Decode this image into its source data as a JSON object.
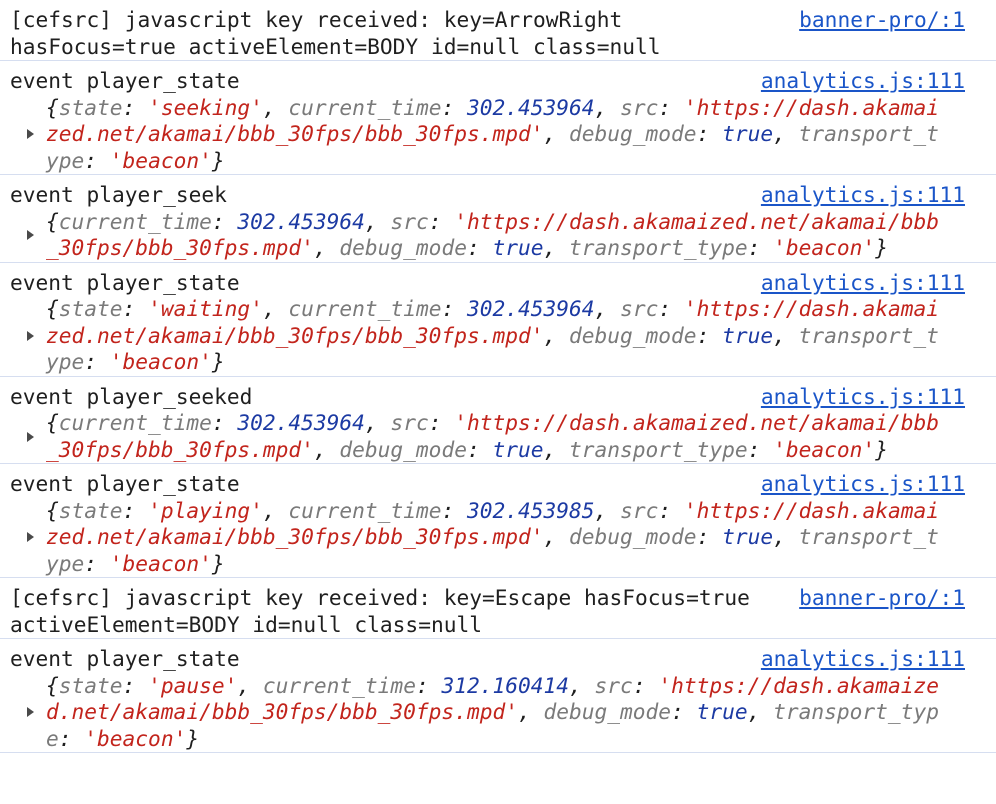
{
  "console": {
    "entries": [
      {
        "kind": "text",
        "lines": [
          "[cefsrc] javascript key received: key=ArrowRight",
          "hasFocus=true activeElement=BODY id=null class=null"
        ],
        "source": "banner-pro/:1"
      },
      {
        "kind": "object",
        "title": "event player_state",
        "source": "analytics.js:111",
        "lines": [
          [
            [
              "p",
              "{"
            ],
            [
              "k",
              "state"
            ],
            [
              "p",
              ": "
            ],
            [
              "s",
              "'seeking'"
            ],
            [
              "p",
              ", "
            ],
            [
              "k",
              "current_time"
            ],
            [
              "p",
              ": "
            ],
            [
              "n",
              "302.453964"
            ],
            [
              "p",
              ", "
            ],
            [
              "k",
              "src"
            ],
            [
              "p",
              ": "
            ],
            [
              "s",
              "'https://dash.akamai"
            ]
          ],
          [
            [
              "s",
              "zed.net/akamai/bbb_30fps/bbb_30fps.mpd'"
            ],
            [
              "p",
              ", "
            ],
            [
              "k",
              "debug_mode"
            ],
            [
              "p",
              ": "
            ],
            [
              "b",
              "true"
            ],
            [
              "p",
              ", "
            ],
            [
              "k",
              "transport_t"
            ]
          ],
          [
            [
              "k",
              "ype"
            ],
            [
              "p",
              ": "
            ],
            [
              "s",
              "'beacon'"
            ],
            [
              "p",
              "}"
            ]
          ]
        ]
      },
      {
        "kind": "object",
        "title": "event player_seek",
        "source": "analytics.js:111",
        "lines": [
          [
            [
              "p",
              "{"
            ],
            [
              "k",
              "current_time"
            ],
            [
              "p",
              ": "
            ],
            [
              "n",
              "302.453964"
            ],
            [
              "p",
              ", "
            ],
            [
              "k",
              "src"
            ],
            [
              "p",
              ": "
            ],
            [
              "s",
              "'https://dash.akamaized.net/akamai/bbb"
            ]
          ],
          [
            [
              "s",
              "_30fps/bbb_30fps.mpd'"
            ],
            [
              "p",
              ", "
            ],
            [
              "k",
              "debug_mode"
            ],
            [
              "p",
              ": "
            ],
            [
              "b",
              "true"
            ],
            [
              "p",
              ", "
            ],
            [
              "k",
              "transport_type"
            ],
            [
              "p",
              ": "
            ],
            [
              "s",
              "'beacon'"
            ],
            [
              "p",
              "}"
            ]
          ]
        ]
      },
      {
        "kind": "object",
        "title": "event player_state",
        "source": "analytics.js:111",
        "lines": [
          [
            [
              "p",
              "{"
            ],
            [
              "k",
              "state"
            ],
            [
              "p",
              ": "
            ],
            [
              "s",
              "'waiting'"
            ],
            [
              "p",
              ", "
            ],
            [
              "k",
              "current_time"
            ],
            [
              "p",
              ": "
            ],
            [
              "n",
              "302.453964"
            ],
            [
              "p",
              ", "
            ],
            [
              "k",
              "src"
            ],
            [
              "p",
              ": "
            ],
            [
              "s",
              "'https://dash.akamai"
            ]
          ],
          [
            [
              "s",
              "zed.net/akamai/bbb_30fps/bbb_30fps.mpd'"
            ],
            [
              "p",
              ", "
            ],
            [
              "k",
              "debug_mode"
            ],
            [
              "p",
              ": "
            ],
            [
              "b",
              "true"
            ],
            [
              "p",
              ", "
            ],
            [
              "k",
              "transport_t"
            ]
          ],
          [
            [
              "k",
              "ype"
            ],
            [
              "p",
              ": "
            ],
            [
              "s",
              "'beacon'"
            ],
            [
              "p",
              "}"
            ]
          ]
        ]
      },
      {
        "kind": "object",
        "title": "event player_seeked",
        "source": "analytics.js:111",
        "lines": [
          [
            [
              "p",
              "{"
            ],
            [
              "k",
              "current_time"
            ],
            [
              "p",
              ": "
            ],
            [
              "n",
              "302.453964"
            ],
            [
              "p",
              ", "
            ],
            [
              "k",
              "src"
            ],
            [
              "p",
              ": "
            ],
            [
              "s",
              "'https://dash.akamaized.net/akamai/bbb"
            ]
          ],
          [
            [
              "s",
              "_30fps/bbb_30fps.mpd'"
            ],
            [
              "p",
              ", "
            ],
            [
              "k",
              "debug_mode"
            ],
            [
              "p",
              ": "
            ],
            [
              "b",
              "true"
            ],
            [
              "p",
              ", "
            ],
            [
              "k",
              "transport_type"
            ],
            [
              "p",
              ": "
            ],
            [
              "s",
              "'beacon'"
            ],
            [
              "p",
              "}"
            ]
          ]
        ]
      },
      {
        "kind": "object",
        "title": "event player_state",
        "source": "analytics.js:111",
        "lines": [
          [
            [
              "p",
              "{"
            ],
            [
              "k",
              "state"
            ],
            [
              "p",
              ": "
            ],
            [
              "s",
              "'playing'"
            ],
            [
              "p",
              ", "
            ],
            [
              "k",
              "current_time"
            ],
            [
              "p",
              ": "
            ],
            [
              "n",
              "302.453985"
            ],
            [
              "p",
              ", "
            ],
            [
              "k",
              "src"
            ],
            [
              "p",
              ": "
            ],
            [
              "s",
              "'https://dash.akamai"
            ]
          ],
          [
            [
              "s",
              "zed.net/akamai/bbb_30fps/bbb_30fps.mpd'"
            ],
            [
              "p",
              ", "
            ],
            [
              "k",
              "debug_mode"
            ],
            [
              "p",
              ": "
            ],
            [
              "b",
              "true"
            ],
            [
              "p",
              ", "
            ],
            [
              "k",
              "transport_t"
            ]
          ],
          [
            [
              "k",
              "ype"
            ],
            [
              "p",
              ": "
            ],
            [
              "s",
              "'beacon'"
            ],
            [
              "p",
              "}"
            ]
          ]
        ]
      },
      {
        "kind": "text",
        "lines": [
          "[cefsrc] javascript key received: key=Escape hasFocus=true",
          "activeElement=BODY id=null class=null"
        ],
        "source": "banner-pro/:1"
      },
      {
        "kind": "object",
        "title": "event player_state",
        "source": "analytics.js:111",
        "lines": [
          [
            [
              "p",
              "{"
            ],
            [
              "k",
              "state"
            ],
            [
              "p",
              ": "
            ],
            [
              "s",
              "'pause'"
            ],
            [
              "p",
              ", "
            ],
            [
              "k",
              "current_time"
            ],
            [
              "p",
              ": "
            ],
            [
              "n",
              "312.160414"
            ],
            [
              "p",
              ", "
            ],
            [
              "k",
              "src"
            ],
            [
              "p",
              ": "
            ],
            [
              "s",
              "'https://dash.akamaize"
            ]
          ],
          [
            [
              "s",
              "d.net/akamai/bbb_30fps/bbb_30fps.mpd'"
            ],
            [
              "p",
              ", "
            ],
            [
              "k",
              "debug_mode"
            ],
            [
              "p",
              ": "
            ],
            [
              "b",
              "true"
            ],
            [
              "p",
              ", "
            ],
            [
              "k",
              "transport_typ"
            ]
          ],
          [
            [
              "k",
              "e"
            ],
            [
              "p",
              ": "
            ],
            [
              "s",
              "'beacon'"
            ],
            [
              "p",
              "}"
            ]
          ]
        ]
      }
    ]
  }
}
